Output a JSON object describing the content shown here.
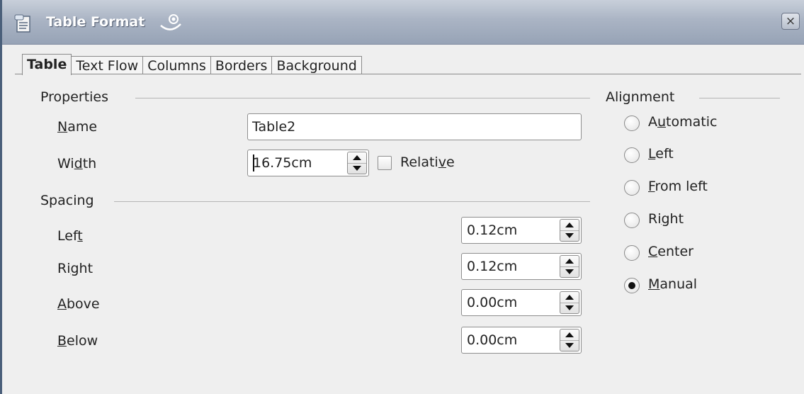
{
  "window": {
    "title": "Table Format",
    "close_symbol": "×"
  },
  "tabs": [
    {
      "label": "Table",
      "active": true
    },
    {
      "label": "Text Flow",
      "active": false
    },
    {
      "label": "Columns",
      "active": false
    },
    {
      "label": "Borders",
      "active": false
    },
    {
      "label": "Background",
      "active": false
    }
  ],
  "properties": {
    "header": "Properties",
    "name": {
      "label_pre": "",
      "label_u": "N",
      "label_post": "ame",
      "value": "Table2"
    },
    "width": {
      "label_pre": "Wi",
      "label_u": "d",
      "label_post": "th",
      "value": "16.75cm"
    },
    "relative": {
      "label_pre": "Relati",
      "label_u": "v",
      "label_post": "e",
      "checked": false
    }
  },
  "spacing": {
    "header": "Spacing",
    "left": {
      "label_pre": "Lef",
      "label_u": "t",
      "label_post": "",
      "value": "0.12cm"
    },
    "right": {
      "label_pre": "Ri",
      "label_u": "g",
      "label_post": "ht",
      "value": "0.12cm"
    },
    "above": {
      "label_pre": "",
      "label_u": "A",
      "label_post": "bove",
      "value": "0.00cm"
    },
    "below": {
      "label_pre": "",
      "label_u": "B",
      "label_post": "elow",
      "value": "0.00cm"
    }
  },
  "alignment": {
    "header": "Alignment",
    "options": [
      {
        "label_pre": "A",
        "label_u": "u",
        "label_post": "tomatic",
        "selected": false
      },
      {
        "label_pre": "",
        "label_u": "L",
        "label_post": "eft",
        "selected": false
      },
      {
        "label_pre": "",
        "label_u": "F",
        "label_post": "rom left",
        "selected": false
      },
      {
        "label_pre": "Ri",
        "label_u": "g",
        "label_post": "ht",
        "selected": false
      },
      {
        "label_pre": "",
        "label_u": "C",
        "label_post": "enter",
        "selected": false
      },
      {
        "label_pre": "",
        "label_u": "M",
        "label_post": "anual",
        "selected": true
      }
    ]
  },
  "colors": {
    "titlebar": "#aab4c4",
    "dialog_bg": "#efefef",
    "border": "#8e8e8e"
  }
}
